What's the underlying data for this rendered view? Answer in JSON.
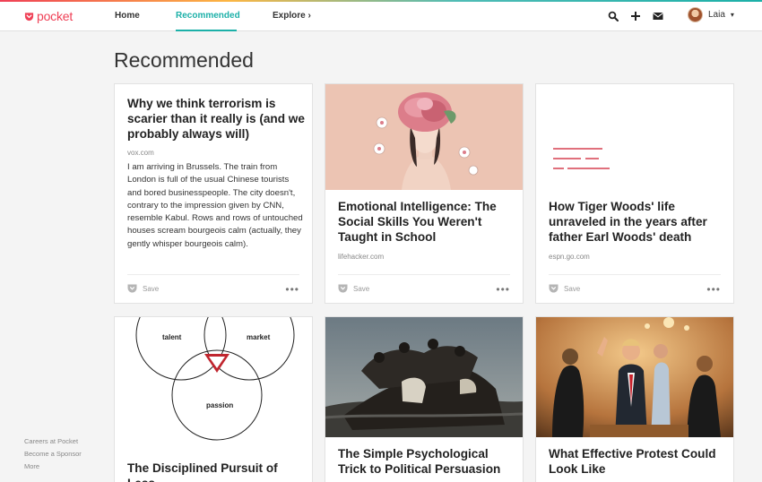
{
  "brand": {
    "name": "pocket",
    "color": "#ef4056",
    "accent": "#1cb0a8"
  },
  "nav": {
    "home": "Home",
    "recommended": "Recommended",
    "explore": "Explore"
  },
  "header_icons": [
    "search-icon",
    "add-icon",
    "mail-icon"
  ],
  "user": {
    "name": "Laia"
  },
  "page": {
    "title": "Recommended"
  },
  "cards": [
    {
      "title": "Why we think terrorism is scarier than it really is (and we probably always will)",
      "domain": "vox.com",
      "excerpt": "I am arriving in Brussels. The train from London is full of the usual Chinese tourists and bored businesspeople. The city doesn't, contrary to the impression given by CNN, resemble Kabul. Rows and rows of untouched houses scream bourgeois calm (actually, they gently whisper bourgeois calm).",
      "save_label": "Save"
    },
    {
      "title": "Emotional Intelligence: The Social Skills You Weren't Taught in School",
      "domain": "lifehacker.com",
      "save_label": "Save"
    },
    {
      "title": "How Tiger Woods' life unraveled in the years after father Earl Woods' death",
      "domain": "espn.go.com",
      "save_label": "Save"
    },
    {
      "title": "The Disciplined Pursuit of Less",
      "venn_labels": [
        "talent",
        "market",
        "passion"
      ]
    },
    {
      "title": "The Simple Psychological Trick to Political Persuasion"
    },
    {
      "title": "What Effective Protest Could Look Like"
    }
  ],
  "footer": {
    "careers": "Careers at Pocket",
    "sponsor": "Become a Sponsor",
    "more": "More"
  }
}
